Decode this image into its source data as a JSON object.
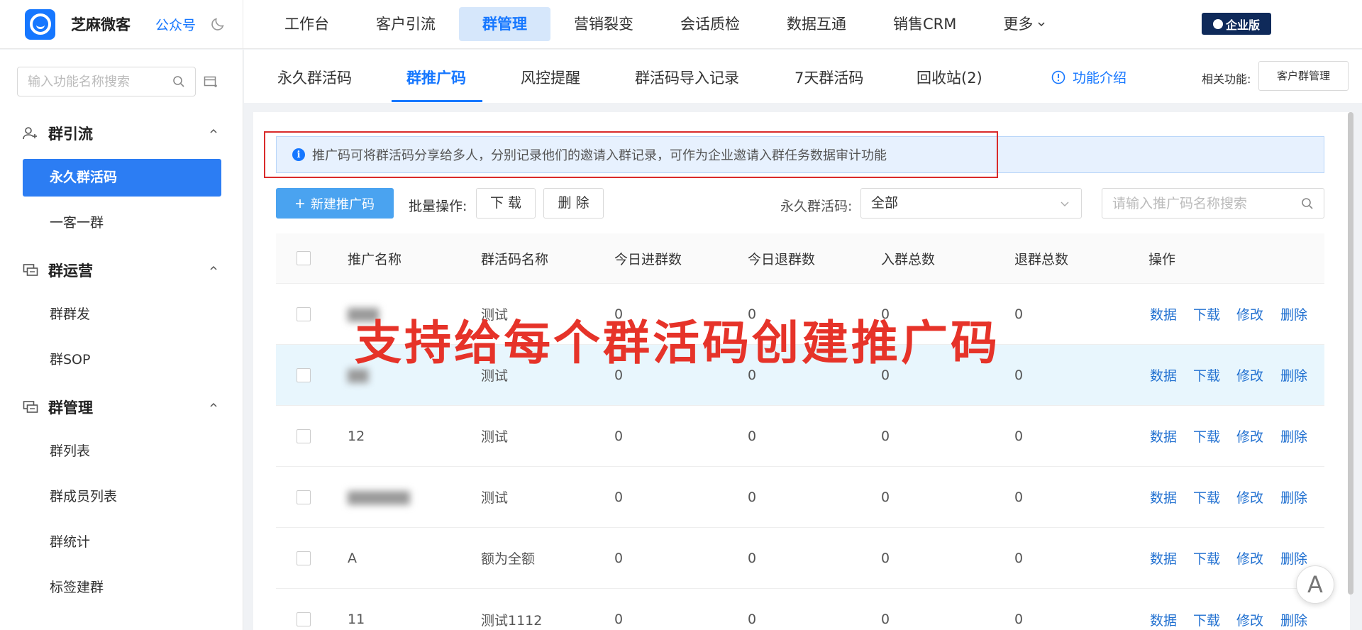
{
  "header": {
    "brand_name": "芝麻微客",
    "wechat_link": "公众号",
    "nav": [
      "工作台",
      "客户引流",
      "群管理",
      "营销裂变",
      "会话质检",
      "数据互通",
      "销售CRM",
      "更多"
    ],
    "active_nav": "群管理",
    "enterprise_badge": "企业版"
  },
  "sidebar": {
    "search_placeholder": "输入功能名称搜索",
    "groups": [
      {
        "label": "群引流",
        "items": [
          "永久群活码",
          "一客一群"
        ]
      },
      {
        "label": "群运营",
        "items": [
          "群群发",
          "群SOP"
        ]
      },
      {
        "label": "群管理",
        "items": [
          "群列表",
          "群成员列表",
          "群统计",
          "标签建群"
        ]
      }
    ],
    "active_item": "永久群活码"
  },
  "subtabs": {
    "items": [
      "永久群活码",
      "群推广码",
      "风控提醒",
      "群活码导入记录",
      "7天群活码",
      "回收站(2)"
    ],
    "active": "群推广码",
    "func_intro": "功能介绍",
    "related_label": "相关功能:",
    "related_button": "客户群管理"
  },
  "notice": "推广码可将群活码分享给多人，分别记录他们的邀请入群记录，可作为企业邀请入群任务数据审计功能",
  "toolbar": {
    "new_button": "新建推广码",
    "batch_label": "批量操作:",
    "download": "下 载",
    "delete": "删 除",
    "filter_label": "永久群活码:",
    "filter_value": "全部",
    "search_placeholder": "请输入推广码名称搜索"
  },
  "table": {
    "columns": [
      "推广名称",
      "群活码名称",
      "今日进群数",
      "今日退群数",
      "入群总数",
      "退群总数",
      "操作"
    ],
    "actions": [
      "数据",
      "下载",
      "修改",
      "删除"
    ],
    "rows": [
      {
        "name": "",
        "code": "测试",
        "today_in": "0",
        "today_out": "0",
        "total_in": "0",
        "total_out": "0"
      },
      {
        "name": "",
        "code": "测试",
        "today_in": "0",
        "today_out": "0",
        "total_in": "0",
        "total_out": "0"
      },
      {
        "name": "12",
        "code": "测试",
        "today_in": "0",
        "today_out": "0",
        "total_in": "0",
        "total_out": "0"
      },
      {
        "name": "",
        "code": "测试",
        "today_in": "0",
        "today_out": "0",
        "total_in": "0",
        "total_out": "0"
      },
      {
        "name": "A",
        "code": "额为全额",
        "today_in": "0",
        "today_out": "0",
        "total_in": "0",
        "total_out": "0"
      },
      {
        "name": "11",
        "code": "测试1112",
        "today_in": "0",
        "today_out": "0",
        "total_in": "0",
        "total_out": "0"
      }
    ]
  },
  "overlay_caption": "支持给每个群活码创建推广码",
  "float_button": "A",
  "colors": {
    "accent": "#1677ff",
    "active_sidebar": "#2c7df3",
    "highlight_border": "#d92b2b",
    "caption": "#e63329"
  }
}
